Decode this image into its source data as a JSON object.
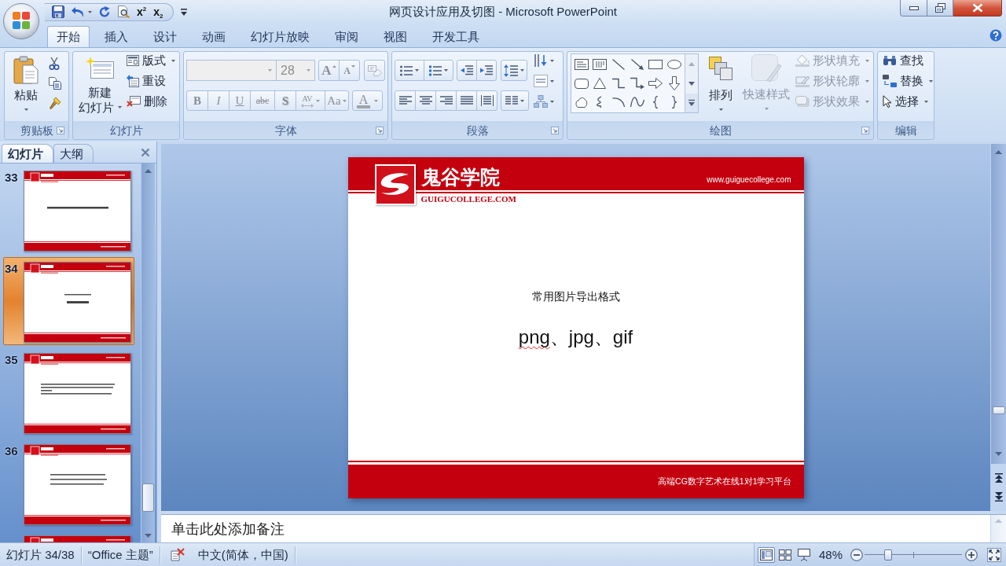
{
  "window": {
    "title": "网页设计应用及切图 - Microsoft PowerPoint"
  },
  "quick_access": {
    "glyph_buttons": [
      "x$^{2}$",
      "x$_{2}$"
    ]
  },
  "tabs": [
    {
      "label": "开始",
      "selected": true
    },
    {
      "label": "插入",
      "selected": false
    },
    {
      "label": "设计",
      "selected": false
    },
    {
      "label": "动画",
      "selected": false
    },
    {
      "label": "幻灯片放映",
      "selected": false
    },
    {
      "label": "审阅",
      "selected": false
    },
    {
      "label": "视图",
      "selected": false
    },
    {
      "label": "开发工具",
      "selected": false
    }
  ],
  "ribbon": {
    "clipboard": {
      "label": "剪贴板",
      "paste": "粘贴"
    },
    "slides": {
      "label": "幻灯片",
      "new_slide": [
        "新建",
        "幻灯片"
      ],
      "commands": [
        {
          "kind": "layout",
          "label": "版式",
          "dropdown": true
        },
        {
          "kind": "reset",
          "label": "重设",
          "dropdown": false
        },
        {
          "kind": "delete",
          "label": "删除",
          "dropdown": false
        }
      ]
    },
    "font": {
      "label": "字体",
      "disabled": true,
      "font_size": "28",
      "grow_glyph": "A",
      "shrink_glyph": "A",
      "format_buttons": [
        {
          "kind": "bold",
          "glyph": "B"
        },
        {
          "kind": "italic",
          "glyph": "I"
        },
        {
          "kind": "underline",
          "glyph": "U"
        },
        {
          "kind": "strikethrough",
          "glyph": "abc"
        },
        {
          "kind": "shadow",
          "glyph": "S"
        },
        {
          "kind": "spacing",
          "glyph": "AV"
        },
        {
          "kind": "case",
          "glyph": "Aa"
        }
      ],
      "color_glyph": "A"
    },
    "paragraph": {
      "label": "段落"
    },
    "drawing": {
      "label": "绘图",
      "arrange": "排列",
      "quick_styles": {
        "label": "快速样式",
        "disabled": true
      },
      "shape_options": [
        {
          "kind": "fill",
          "label": "形状填充",
          "disabled": true
        },
        {
          "kind": "outline",
          "label": "形状轮廓",
          "disabled": true
        },
        {
          "kind": "effects",
          "label": "形状效果",
          "disabled": true
        }
      ]
    },
    "editing": {
      "label": "编辑",
      "commands": [
        {
          "kind": "find",
          "label": "查找",
          "dropdown": false
        },
        {
          "kind": "replace",
          "label": "替换",
          "dropdown": true
        },
        {
          "kind": "select",
          "label": "选择",
          "dropdown": true
        }
      ]
    }
  },
  "panel": {
    "tabs": [
      {
        "label": "幻灯片",
        "selected": true
      },
      {
        "label": "大纲",
        "selected": false
      }
    ],
    "thumbnails": [
      {
        "number": "33",
        "kind": "one_line",
        "selected": false
      },
      {
        "number": "34",
        "kind": "two_line",
        "selected": true
      },
      {
        "number": "35",
        "kind": "paragraphs",
        "selected": false
      },
      {
        "number": "36",
        "kind": "list",
        "selected": false
      },
      {
        "kind": "blank",
        "selected": false
      }
    ]
  },
  "slide": {
    "brand": "鬼谷学院",
    "domain": "GUIGUCOLLEGE.COM",
    "url": "www.guiguecollege.com",
    "subtitle": "常用图片导出格式",
    "body": [
      {
        "text": "png",
        "misspelled": true
      },
      {
        "text": "、jpg、gif",
        "misspelled": false
      }
    ],
    "footer": "高端CG数字艺术在线1对1学习平台"
  },
  "notes": {
    "placeholder": "单击此处添加备注"
  },
  "status_bar": {
    "slide_info": "幻灯片 34/38",
    "theme": "“Office 主题”",
    "language": "中文(简体，中国)",
    "views": [
      {
        "kind": "normal",
        "selected": true
      },
      {
        "kind": "slide_sorter",
        "selected": false
      },
      {
        "kind": "slide_show",
        "selected": false
      }
    ],
    "zoom": "48%",
    "zoom_slider": {
      "level": 0.24
    }
  }
}
